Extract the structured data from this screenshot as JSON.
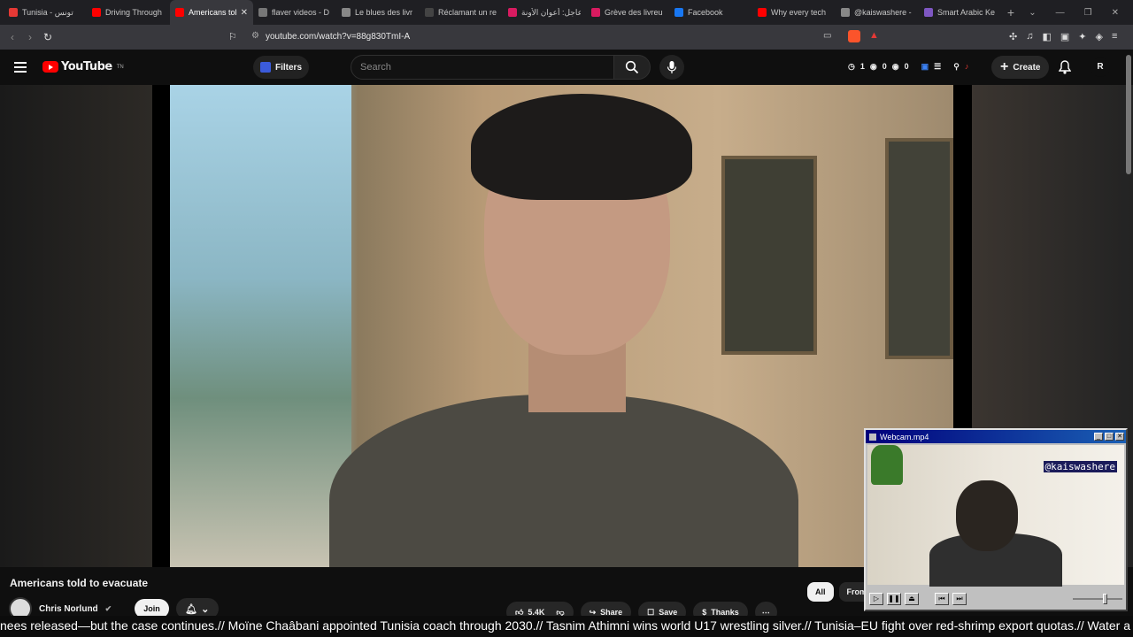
{
  "browser": {
    "tabs": [
      {
        "label": "Tunisia - تونس",
        "color": "#e53935",
        "active": false
      },
      {
        "label": "Driving Through",
        "color": "#ff0000",
        "active": false
      },
      {
        "label": "Americans told",
        "color": "#ff0000",
        "active": true
      },
      {
        "label": "flaver videos - D",
        "color": "#777777",
        "active": false
      },
      {
        "label": "Le blues des livr",
        "color": "#888888",
        "active": false
      },
      {
        "label": "Réclamant un re",
        "color": "#444444",
        "active": false
      },
      {
        "label": "عاجل: أعوان الأونة",
        "color": "#d81b60",
        "active": false
      },
      {
        "label": "Grève des livreu",
        "color": "#d81b60",
        "active": false
      },
      {
        "label": "Facebook",
        "color": "#1877f2",
        "active": false
      },
      {
        "label": "Why every tech",
        "color": "#ff0000",
        "active": false
      },
      {
        "label": "@kaiswashere -",
        "color": "#888888",
        "active": false
      },
      {
        "label": "Smart Arabic Ke",
        "color": "#7e57c2",
        "active": false
      }
    ],
    "url": "youtube.com/watch?v=88g830TmI-A"
  },
  "youtube": {
    "logo_text": "YouTube",
    "logo_sup": "TN",
    "filters_label": "Filters",
    "search_placeholder": "Search",
    "stats": [
      "1",
      "0",
      "0"
    ],
    "create_label": "Create",
    "avatar_letter": "R"
  },
  "video": {
    "title": "Americans told to evacuate",
    "channel": "Chris Norlund",
    "join_label": "Join",
    "like_count": "5.4K",
    "share_label": "Share",
    "save_label": "Save",
    "thanks_label": "Thanks",
    "chips": [
      "All",
      "From"
    ]
  },
  "webcam": {
    "title": "Webcam.mp4",
    "tag": "@kaiswashere"
  },
  "ticker": {
    "text": "nees released—but the case continues.// Moïne Chaâbani appointed Tunisia coach through 2030.// Tasnim Athimni wins world U17 wrestling silver.// Tunisia–EU fight over red-shrimp export quotas.// Water a"
  },
  "colors": {
    "accent": "#ff0000",
    "bg": "#0f0f0f"
  }
}
